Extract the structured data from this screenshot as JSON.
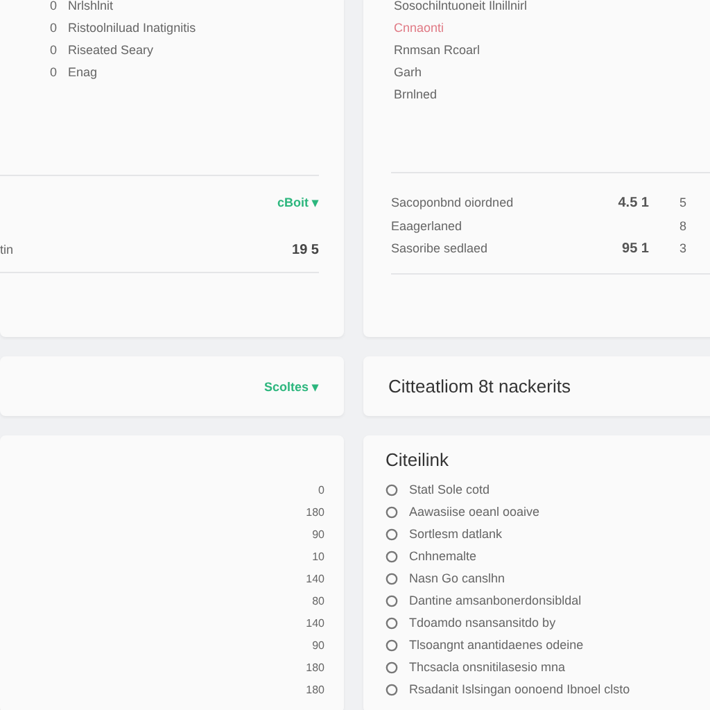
{
  "top_left": {
    "list": [
      {
        "marker": "0",
        "text": "Nrlshlnit"
      },
      {
        "marker": "0",
        "text": "Ristoolniluad Inatignitis"
      },
      {
        "marker": "0",
        "text": "Riseated Seary"
      },
      {
        "marker": "0",
        "text": "Enag"
      }
    ],
    "link": "cBoit ▾",
    "row_label": "tin",
    "row_value": "19 5"
  },
  "top_right": {
    "list": [
      {
        "text": "Sosochilntuoneit Ilnillnirl",
        "highlighted": false
      },
      {
        "text": "Cnnaonti",
        "highlighted": true
      },
      {
        "text": "Rnmsan Rcoarl",
        "highlighted": false
      },
      {
        "text": "Garh",
        "highlighted": false
      },
      {
        "text": "Brnlned",
        "highlighted": false
      }
    ],
    "rows": [
      {
        "label": "Sacoponbnd oiordned",
        "value": "4.5 1",
        "extra": "5"
      },
      {
        "label": "Eaagerlaned",
        "extra": "8"
      },
      {
        "label": "Sasoribe sedlaed",
        "value": "95 1",
        "extra": "3"
      }
    ]
  },
  "left_header": {
    "link": "Scoltes ▾"
  },
  "left_values": [
    "0",
    "180",
    "90",
    "10",
    "140",
    "80",
    "140",
    "90",
    "180",
    "180"
  ],
  "right_header": {
    "title": "Citteatliom 8t nackerits"
  },
  "right_panel": {
    "title": "Citeilink",
    "items": [
      "Statl Sole cotd",
      "Aawasiise oeanl ooaive",
      "Sortlesm datlank",
      "Cnhnemalte",
      "Nasn Go canslhn",
      "Dantine amsanbonerdonsibldal",
      "Tdoamdo nsansansitdo by",
      "Tlsoangnt anantidaenes odeine",
      "Thcsacla onsnitilasesio mna",
      "Rsadanit Islsingan oonoend Ibnoel clsto"
    ]
  }
}
